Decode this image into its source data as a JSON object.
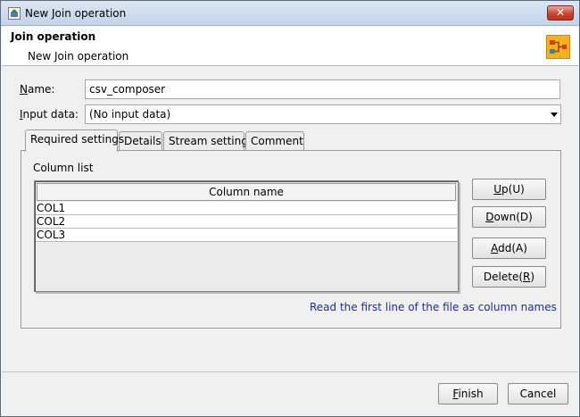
{
  "window": {
    "title": "New Join operation",
    "close_label": "✕"
  },
  "header": {
    "title": "Join operation",
    "subtitle": "New Join operation",
    "icon": "join-node-icon"
  },
  "form": {
    "name_label_mnemonic": "N",
    "name_label_rest": "ame:",
    "name_value": "csv_composer",
    "input_label_mnemonic": "I",
    "input_label_rest": "nput data:",
    "input_value": "(No input data)"
  },
  "tabs": [
    {
      "label": "Required settings",
      "active": true
    },
    {
      "label": "Details",
      "active": false
    },
    {
      "label": "Stream setting",
      "active": false
    },
    {
      "label": "Comment",
      "active": false
    }
  ],
  "column_list": {
    "label": "Column list",
    "header": "Column name",
    "rows": [
      "COL1",
      "COL2",
      "COL3"
    ]
  },
  "buttons": {
    "up": {
      "pre": "",
      "mn": "U",
      "post": "p(U)"
    },
    "down": {
      "pre": "",
      "mn": "D",
      "post": "own(D)"
    },
    "add": {
      "pre": "",
      "mn": "A",
      "post": "dd(A)"
    },
    "delete": {
      "pre": "Delete(",
      "mn": "R",
      "post": ")"
    },
    "finish": {
      "pre": "",
      "mn": "F",
      "post": "inish"
    },
    "cancel": "Cancel"
  },
  "note": "Read the first line of the file as column names",
  "colors": {
    "accent": "#f6b21d",
    "link": "#1e2ba8",
    "close": "#c9452f"
  }
}
